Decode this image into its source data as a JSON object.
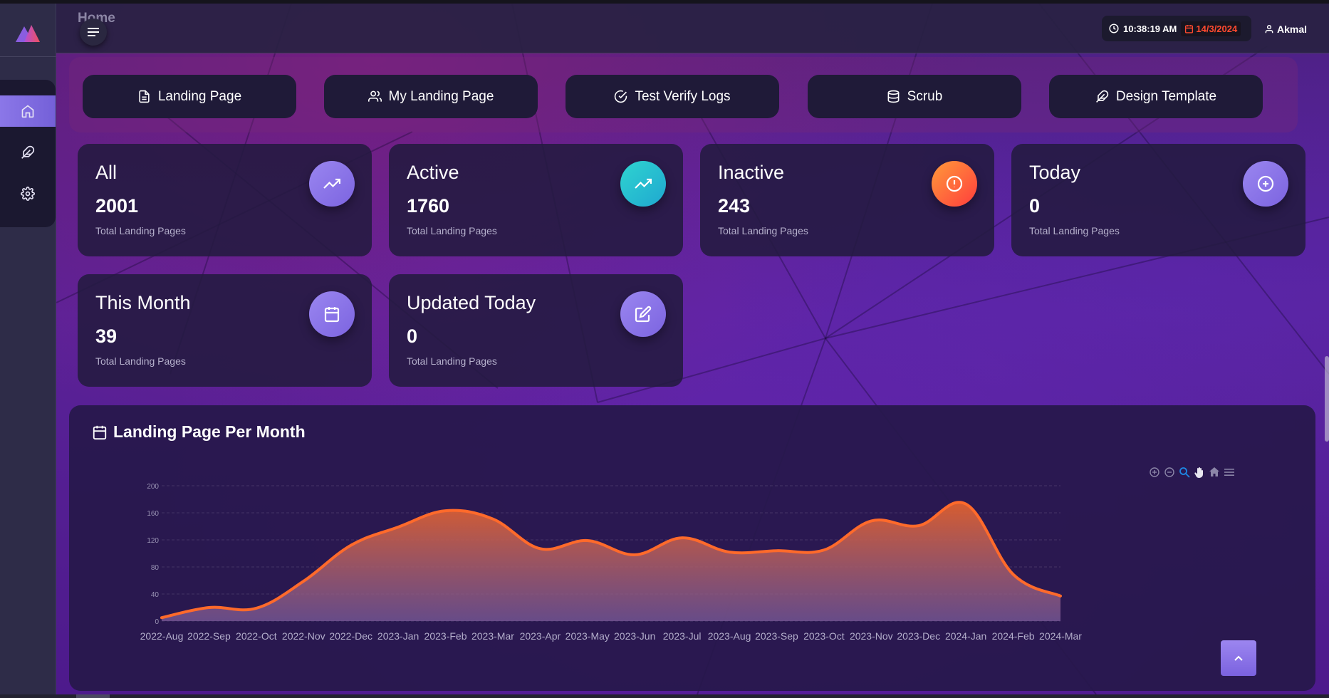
{
  "header": {
    "page_title": "Home",
    "time": "10:38:19 AM",
    "date": "14/3/2024",
    "user": "Akmal"
  },
  "sidebar": {
    "items": [
      {
        "icon": "home-icon",
        "active": true
      },
      {
        "icon": "feather-icon",
        "active": false
      },
      {
        "icon": "gear-icon",
        "active": false
      }
    ]
  },
  "shortcuts": [
    {
      "label": "Landing Page",
      "icon": "document-icon"
    },
    {
      "label": "My Landing Page",
      "icon": "users-icon"
    },
    {
      "label": "Test Verify Logs",
      "icon": "check-circle-icon"
    },
    {
      "label": "Scrub",
      "icon": "database-icon"
    },
    {
      "label": "Design Template",
      "icon": "feather-icon"
    }
  ],
  "stats": [
    {
      "title": "All",
      "value": "2001",
      "sub": "Total Landing Pages",
      "icon": "trending-up-icon",
      "color": "#8a74e6"
    },
    {
      "title": "Active",
      "value": "1760",
      "sub": "Total Landing Pages",
      "icon": "trending-up-icon",
      "color": "#23c3cc"
    },
    {
      "title": "Inactive",
      "value": "243",
      "sub": "Total Landing Pages",
      "icon": "alert-circle-icon",
      "color": "#ff5a36"
    },
    {
      "title": "Today",
      "value": "0",
      "sub": "Total Landing Pages",
      "icon": "plus-circle-icon",
      "color": "#8a74e6"
    },
    {
      "title": "This Month",
      "value": "39",
      "sub": "Total Landing Pages",
      "icon": "calendar-icon",
      "color": "#8a74e6"
    },
    {
      "title": "Updated Today",
      "value": "0",
      "sub": "Total Landing Pages",
      "icon": "edit-icon",
      "color": "#8a74e6"
    }
  ],
  "chart_title": "Landing Page Per Month",
  "chart_data": {
    "type": "area",
    "title": "Landing Page Per Month",
    "xlabel": "",
    "ylabel": "",
    "categories": [
      "2022-Aug",
      "2022-Sep",
      "2022-Oct",
      "2022-Nov",
      "2022-Dec",
      "2023-Jan",
      "2023-Feb",
      "2023-Mar",
      "2023-Apr",
      "2023-May",
      "2023-Jun",
      "2023-Jul",
      "2023-Aug",
      "2023-Sep",
      "2023-Oct",
      "2023-Nov",
      "2023-Dec",
      "2024-Jan",
      "2024-Feb",
      "2024-Mar"
    ],
    "series": [
      {
        "values": [
          5,
          20,
          19,
          59,
          112,
          139,
          163,
          151,
          107,
          119,
          98,
          123,
          102,
          104,
          105,
          148,
          141,
          173,
          69,
          37
        ]
      }
    ],
    "y_ticks": [
      0,
      40,
      80,
      120,
      160,
      200
    ],
    "ylim": [
      0,
      200
    ],
    "grid": true,
    "line_color": "#ff6a2b",
    "fill_color_top": "#e0602e",
    "fill_color_bottom": "#7c5c9a"
  }
}
